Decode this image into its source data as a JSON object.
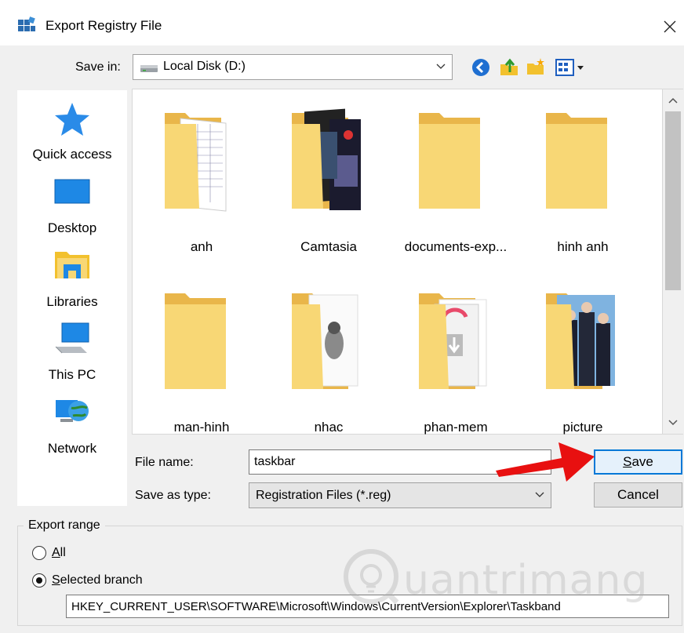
{
  "window": {
    "title": "Export Registry File"
  },
  "save_in": {
    "label": "Save in:",
    "value": "Local Disk (D:)"
  },
  "toolbar_icons": [
    "back-icon",
    "up-folder-icon",
    "new-folder-icon",
    "view-menu-icon"
  ],
  "places": [
    {
      "label": "Quick access",
      "icon": "star-icon"
    },
    {
      "label": "Desktop",
      "icon": "desktop-icon"
    },
    {
      "label": "Libraries",
      "icon": "libraries-icon"
    },
    {
      "label": "This PC",
      "icon": "computer-icon"
    },
    {
      "label": "Network",
      "icon": "network-icon"
    }
  ],
  "folders": [
    {
      "name": "anh"
    },
    {
      "name": "Camtasia"
    },
    {
      "name": "documents-exp..."
    },
    {
      "name": "hinh anh"
    },
    {
      "name": "man-hinh"
    },
    {
      "name": "nhac"
    },
    {
      "name": "phan-mem"
    },
    {
      "name": "picture"
    }
  ],
  "file_name": {
    "label": "File name:",
    "value": "taskbar"
  },
  "save_as_type": {
    "label": "Save as type:",
    "value": "Registration Files (*.reg)"
  },
  "buttons": {
    "save": "Save",
    "cancel": "Cancel"
  },
  "export_range": {
    "title": "Export range",
    "all_label": "All",
    "selected_label": "Selected branch",
    "branch_path": "HKEY_CURRENT_USER\\SOFTWARE\\Microsoft\\Windows\\CurrentVersion\\Explorer\\Taskband"
  },
  "watermark": {
    "text": "uantrimang"
  },
  "colors": {
    "folder": "#f8d775",
    "accent": "#0078d7",
    "arrow": "#e81010"
  }
}
